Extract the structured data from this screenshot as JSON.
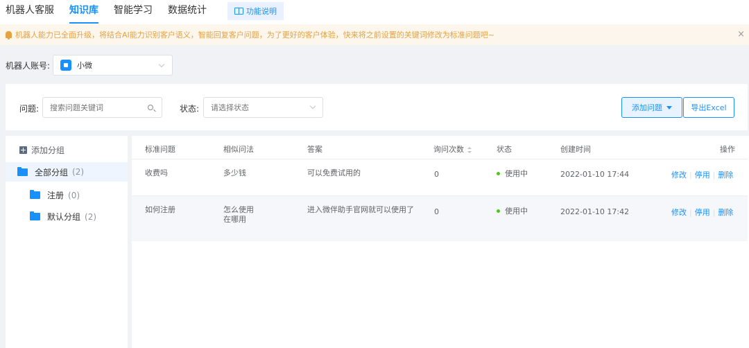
{
  "nav": {
    "tabs": [
      {
        "label": "机器人客服"
      },
      {
        "label": "知识库"
      },
      {
        "label": "智能学习"
      },
      {
        "label": "数据统计"
      }
    ],
    "function_help": "功能说明"
  },
  "notice": {
    "text": "机器人能力已全面升级，将结合AI能力识别客户语义，智能回复客户问题，为了更好的客户体验，快来将之前设置的关键词修改为标准问题吧~",
    "close": "×"
  },
  "account": {
    "label": "机器人账号:",
    "value": "小微"
  },
  "filter": {
    "question_label": "问题:",
    "question_placeholder": "搜索问题关键词",
    "status_label": "状态:",
    "status_placeholder": "请选择状态",
    "add_button": "添加问题",
    "export_button": "导出Excel"
  },
  "sidebar": {
    "add_group": "添加分组",
    "groups": [
      {
        "name": "全部分组",
        "count": "(2)"
      },
      {
        "name": "注册",
        "count": "(0)"
      },
      {
        "name": "默认分组",
        "count": "(2)"
      }
    ]
  },
  "table": {
    "headers": [
      "标准问题",
      "相似问法",
      "答案",
      "询问次数",
      "状态",
      "创建时间",
      "操作"
    ],
    "rows": [
      {
        "question": "收费吗",
        "similar": [
          "多少钱"
        ],
        "answer": "可以免费试用的",
        "asks": "0",
        "status": "使用中",
        "created": "2022-01-10 17:44",
        "ops": [
          "修改",
          "停用",
          "删除"
        ]
      },
      {
        "question": "如何注册",
        "similar": [
          "怎么使用",
          "在哪用"
        ],
        "answer": "进入微伴助手官网就可以使用了",
        "asks": "0",
        "status": "使用中",
        "created": "2022-01-10 17:42",
        "ops": [
          "修改",
          "停用",
          "删除"
        ]
      }
    ]
  },
  "colors": {
    "accent": "#1890ff",
    "notice_bg": "#fdf6ec",
    "notice_text": "#e6a23c",
    "status_ok": "#52c41a"
  }
}
